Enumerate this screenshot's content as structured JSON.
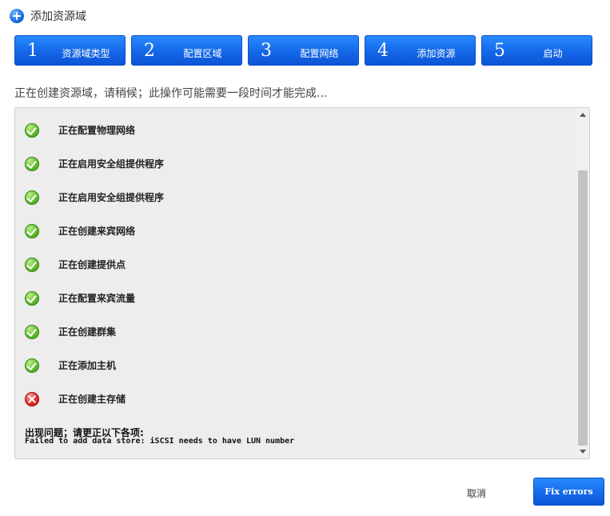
{
  "header": {
    "title": "添加资源域"
  },
  "steps": [
    {
      "num": "1",
      "label": "资源域类型"
    },
    {
      "num": "2",
      "label": "配置区域"
    },
    {
      "num": "3",
      "label": "配置网络"
    },
    {
      "num": "4",
      "label": "添加资源"
    },
    {
      "num": "5",
      "label": "启动"
    }
  ],
  "status_message": "正在创建资源域，请稍候；此操作可能需要一段时间才能完成...",
  "progress_items": [
    {
      "label": "正在配置物理网络",
      "status": "success"
    },
    {
      "label": "正在启用安全组提供程序",
      "status": "success"
    },
    {
      "label": "正在启用安全组提供程序",
      "status": "success"
    },
    {
      "label": "正在创建来宾网络",
      "status": "success"
    },
    {
      "label": "正在创建提供点",
      "status": "success"
    },
    {
      "label": "正在配置来宾流量",
      "status": "success"
    },
    {
      "label": "正在创建群集",
      "status": "success"
    },
    {
      "label": "正在添加主机",
      "status": "success"
    },
    {
      "label": "正在创建主存储",
      "status": "error"
    }
  ],
  "error": {
    "title": "出现问题；请更正以下各项:",
    "detail": "Failed to add data store: iSCSI needs to have LUN number"
  },
  "buttons": {
    "cancel": "取消",
    "fix": "Fix errors"
  },
  "colors": {
    "accent": "#1467e8",
    "success": "#5fb92a",
    "error": "#e02828"
  }
}
